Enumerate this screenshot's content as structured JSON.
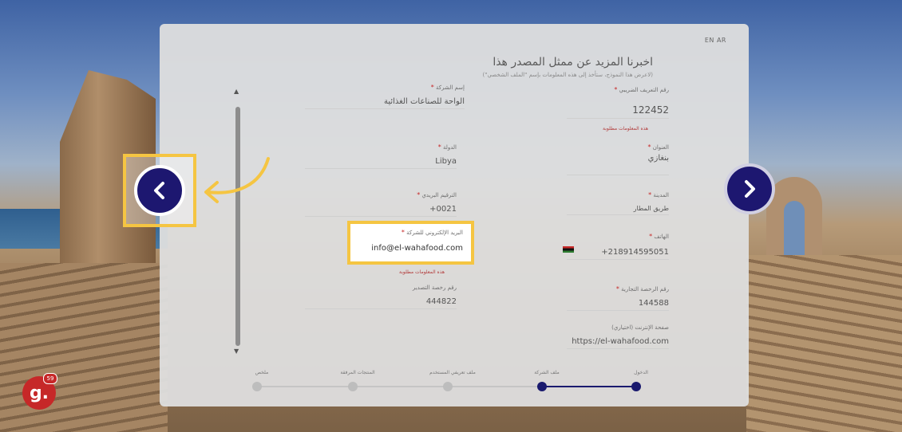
{
  "lang_switch": "EN AR",
  "header": {
    "title": "اخبرنا المزيد عن ممثل المصدر هذا",
    "subtitle": "(لاعرض هذا النموذج، ستأخذ إلى هذه المعلومات بإسم \"الملف الشخصي\")"
  },
  "fields": {
    "company_name": {
      "label": "إسم الشركة",
      "required": "*",
      "value": "الواحة للصناعات الغذائية"
    },
    "commercial_reg": {
      "label": "رقم التعريف الضريبي",
      "required": "*",
      "value": "122452"
    },
    "note_required_1": "هذه المعلومات مطلوبة",
    "country": {
      "label": "الدولة",
      "required": "*",
      "value": "Libya"
    },
    "address": {
      "label": "العنوان",
      "required": "*",
      "value": "بنغازي"
    },
    "postal_code": {
      "label": "الترقيم البريدي",
      "required": "*",
      "value": "0021+"
    },
    "city": {
      "label": "المدينة",
      "required": "*",
      "value": "طريق المطار"
    },
    "email": {
      "label": "البريد الإلكتروني للشركة",
      "required": "*",
      "value": "info@el-wahafood.com"
    },
    "phone": {
      "label": "الهاتف",
      "required": "*",
      "value": "218914595051+"
    },
    "note_required_2": "هذه المعلومات مطلوبة",
    "license_no": {
      "label": "رقم رخصة التصدير",
      "value": "444822"
    },
    "trade_license": {
      "label": "رقم الرخصة التجارية",
      "required": "*",
      "value": "144588"
    },
    "website": {
      "label": "صفحة الإنترنت (اختياري)",
      "value": "https://el-wahafood.com"
    }
  },
  "stepper": {
    "steps": [
      {
        "label": "ملخص",
        "state": "inactive"
      },
      {
        "label": "المنتجات المرفقة",
        "state": "inactive"
      },
      {
        "label": "ملف تعريفي المستخدم",
        "state": "inactive"
      },
      {
        "label": "ملف الشركة",
        "state": "active"
      },
      {
        "label": "الدخول",
        "state": "active"
      }
    ]
  },
  "nav": {
    "prev_icon": "chevron-left-icon",
    "next_icon": "chevron-right-icon"
  },
  "logo": {
    "text": "g.",
    "badge": "59"
  },
  "colors": {
    "accent": "#1d1770",
    "highlight": "#f5c542",
    "required": "#c62828"
  }
}
